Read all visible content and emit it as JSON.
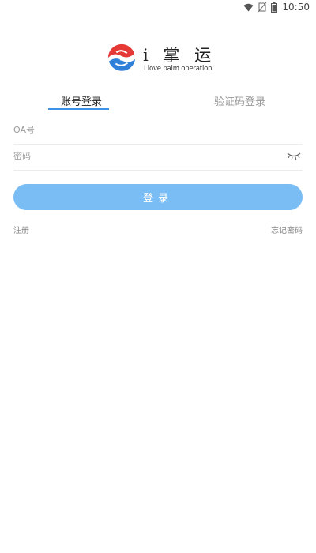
{
  "status_bar": {
    "time": "10:50",
    "icons": [
      "wifi-icon",
      "no-sim-icon",
      "battery-icon"
    ]
  },
  "logo": {
    "title": "i 掌 运",
    "subtitle": "I love palm operation",
    "colors": {
      "red": "#e53935",
      "blue": "#2f80d8"
    }
  },
  "tabs": [
    {
      "label": "账号登录",
      "active": true
    },
    {
      "label": "验证码登录",
      "active": false
    }
  ],
  "form": {
    "oa_placeholder": "OA号",
    "password_placeholder": "密码"
  },
  "login_button": {
    "label": "登录"
  },
  "links": {
    "register": "注册",
    "forgot_password": "忘记密码"
  },
  "colors": {
    "accent": "#3d94e6",
    "button": "#7abcf4"
  }
}
